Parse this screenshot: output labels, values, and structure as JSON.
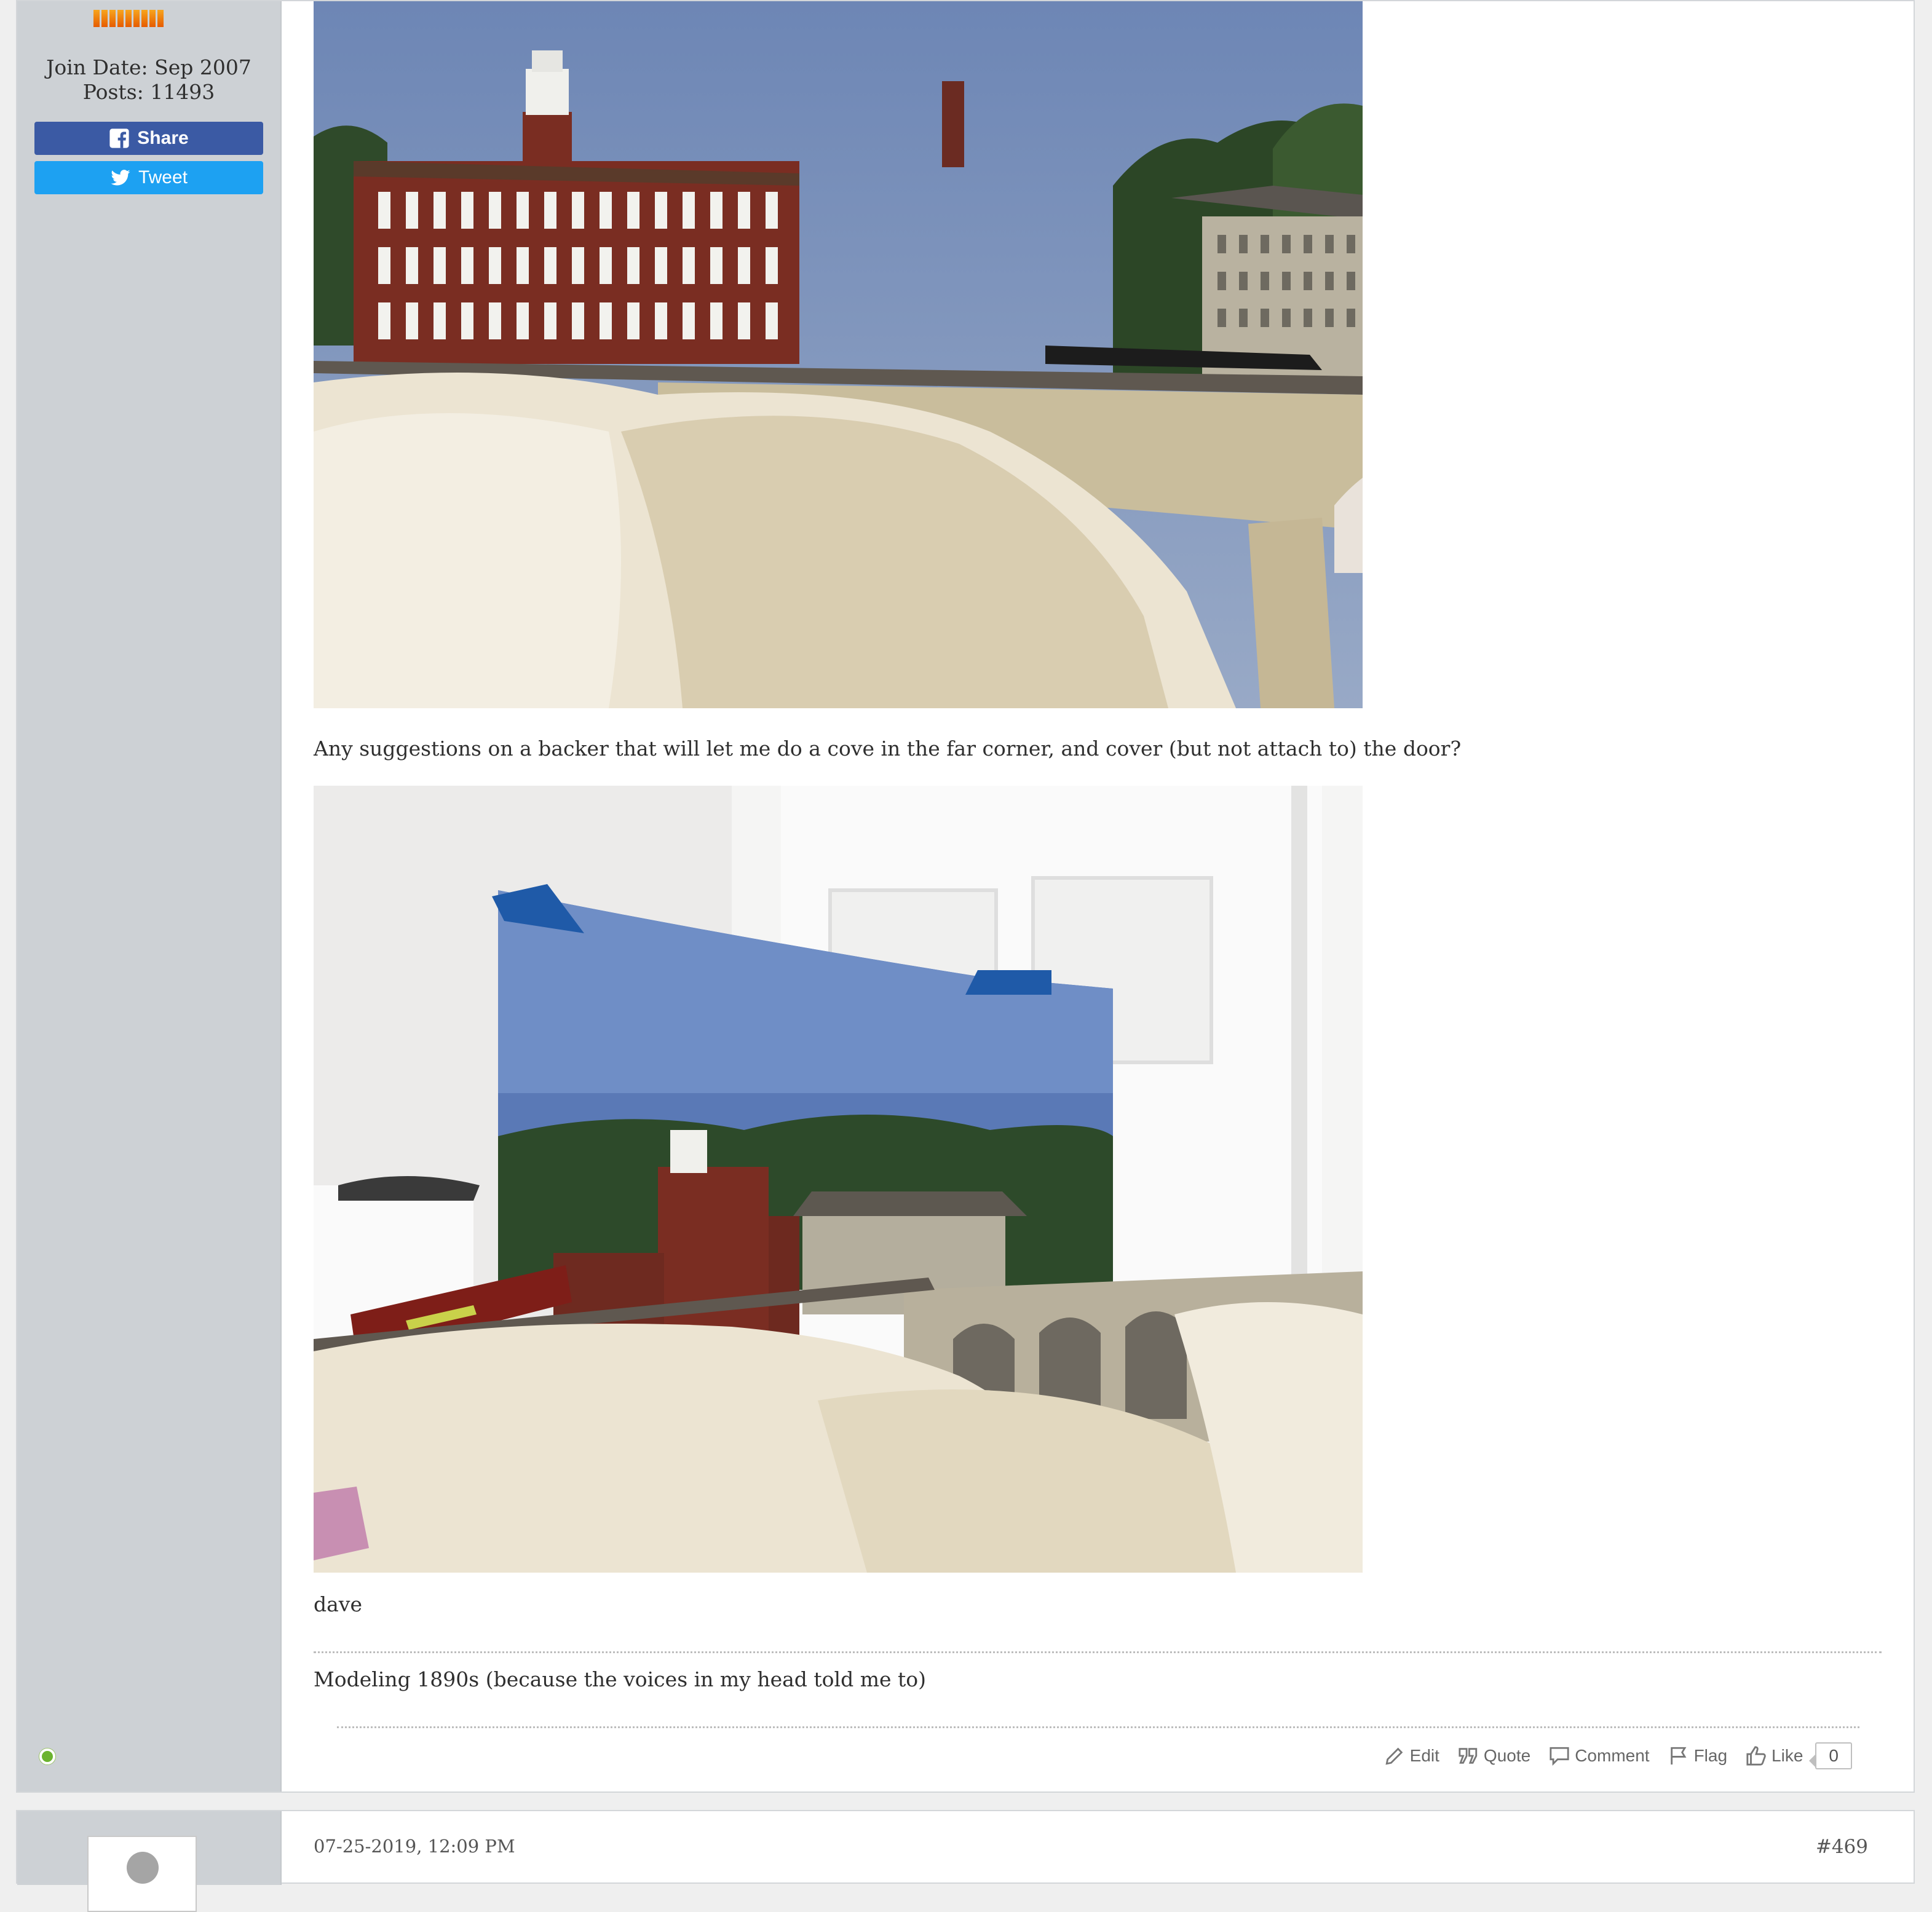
{
  "user": {
    "join_date": "Join Date: Sep 2007",
    "posts": "Posts: 11493",
    "rank_bars": 9
  },
  "social": {
    "share_label": "Share",
    "tweet_label": "Tweet",
    "share_color": "#3b5aa4",
    "tweet_color": "#1da1f2"
  },
  "post": {
    "question": "Any suggestions on a backer that will let me do a cove in the far corner, and cover (but not attach to) the door?",
    "signature_name": "dave",
    "signature": "Modeling 1890s (because the voices in my head told me to)"
  },
  "actions": {
    "edit": "Edit",
    "quote": "Quote",
    "comment": "Comment",
    "flag": "Flag",
    "like": "Like",
    "like_count": "0"
  },
  "next_post": {
    "date": "07-25-2019, 12:09 PM",
    "number": "#469"
  },
  "colors": {
    "online_status": "#6bb32e",
    "sidebar_bg": "#cdd1d5"
  }
}
